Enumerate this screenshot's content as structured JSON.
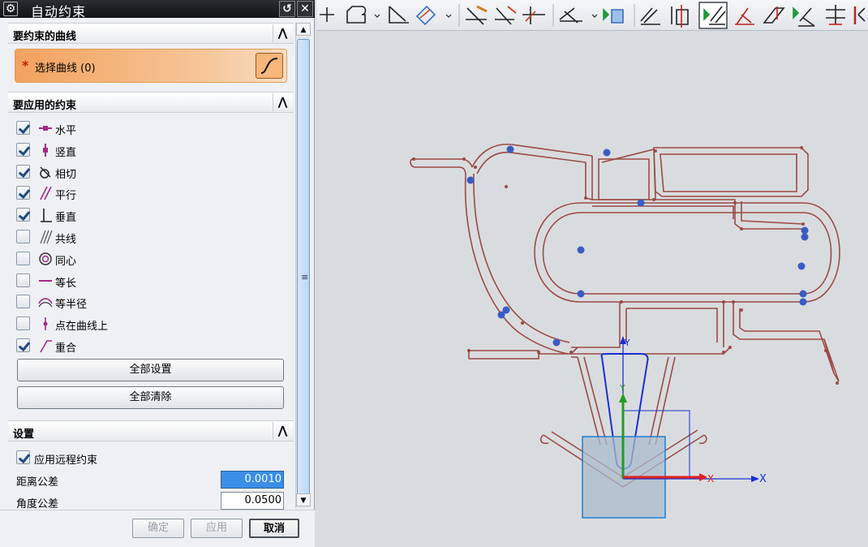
{
  "dialog": {
    "title": "自动约束",
    "gear_glyph": "⚙",
    "reset_glyph": "↺",
    "close_glyph": "✕"
  },
  "curves_section": {
    "header": "要约束的曲线",
    "collapse_glyph": "⋀",
    "required_mark": "*",
    "select_label": "选择曲线 (0)"
  },
  "constraints_section": {
    "header": "要应用的约束",
    "collapse_glyph": "⋀",
    "items": [
      {
        "label": "水平",
        "checked": true,
        "icon": "horizontal-icon"
      },
      {
        "label": "竖直",
        "checked": true,
        "icon": "vertical-icon"
      },
      {
        "label": "相切",
        "checked": true,
        "icon": "tangent-icon"
      },
      {
        "label": "平行",
        "checked": true,
        "icon": "parallel-icon"
      },
      {
        "label": "垂直",
        "checked": true,
        "icon": "perpendicular-icon"
      },
      {
        "label": "共线",
        "checked": false,
        "icon": "collinear-icon"
      },
      {
        "label": "同心",
        "checked": false,
        "icon": "concentric-icon"
      },
      {
        "label": "等长",
        "checked": false,
        "icon": "equal-length-icon"
      },
      {
        "label": "等半径",
        "checked": false,
        "icon": "equal-radius-icon"
      },
      {
        "label": "点在曲线上",
        "checked": false,
        "icon": "point-on-curve-icon"
      },
      {
        "label": "重合",
        "checked": true,
        "icon": "coincident-icon"
      }
    ],
    "set_all_label": "全部设置",
    "clear_all_label": "全部清除"
  },
  "settings_section": {
    "header": "设置",
    "collapse_glyph": "⋀",
    "remote_label": "应用远程约束",
    "remote_checked": true,
    "distance_label": "距离公差",
    "distance_value": "0.0010",
    "angle_label": "角度公差",
    "angle_value": "0.0500"
  },
  "scrollbar": {
    "up_glyph": "▲",
    "down_glyph": "▼",
    "grip_glyph": "≡"
  },
  "footer": {
    "ok_label": "确定",
    "apply_label": "应用",
    "cancel_label": "取消"
  },
  "canvas": {
    "axis_x_label": "X",
    "axis_y_label": "Y",
    "axis_colors": {
      "x": "#1a2fd0",
      "y": "#1a2fd0",
      "x_local": "#e02020",
      "y_local": "#20a020"
    },
    "curve_color": "#9b4a45",
    "point_color": "#3b5bc4"
  },
  "toolbar_icons": [
    "point-icon",
    "profile-icon",
    "trim-corner-icon",
    "derived-line-icon",
    "quick-trim-icon",
    "quick-extend-icon",
    "make-corner-icon",
    "rapid-dimension-icon",
    "continuous-dimension-icon",
    "geometric-constraints-icon",
    "show-constraints-icon",
    "auto-constrain-icon",
    "relax-dimension-icon",
    "convert-reference-icon",
    "alternate-solution-icon",
    "animate-dimension-icon",
    "inferred-constraints-icon"
  ]
}
